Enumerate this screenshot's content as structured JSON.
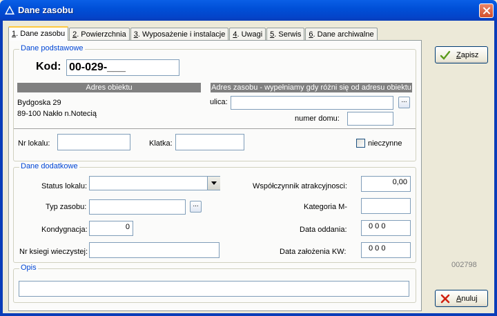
{
  "window": {
    "title": "Dane zasobu",
    "accent": "#0050d8"
  },
  "tabs": [
    {
      "key": "1",
      "label": ". Dane zasobu"
    },
    {
      "key": "2",
      "label": ". Powierzchnia"
    },
    {
      "key": "3",
      "label": ". Wyposażenie i instalacje"
    },
    {
      "key": "4",
      "label": ". Uwagi"
    },
    {
      "key": "5",
      "label": ". Serwis"
    },
    {
      "key": "6",
      "label": ". Dane archiwalne"
    }
  ],
  "basic": {
    "group_label": "Dane podstawowe",
    "code_label": "Kod:",
    "code_value": "00-029-___",
    "object_address_header": "Adres  obiektu",
    "object_address_line1": "Bydgoska 29",
    "object_address_line2": "89-100 Nakło n.Notecią",
    "resource_address_header": "Adres zasobu - wypełniamy gdy różni się od adresu obiektu",
    "street_label": "ulica:",
    "street_value": "",
    "house_number_label": "numer domu:",
    "house_number_value": "",
    "unit_number_label": "Nr lokalu:",
    "unit_number_value": "",
    "staircase_label": "Klatka:",
    "staircase_value": "",
    "inactive_label": "nieczynne",
    "browse_label": "..."
  },
  "additional": {
    "group_label": "Dane dodatkowe",
    "unit_status_label": "Status lokalu:",
    "unit_status_value": "",
    "resource_type_label": "Typ zasobu:",
    "resource_type_value": "",
    "floors_label": "Kondygnacja:",
    "floors_value": "0",
    "land_register_label": "Nr ksiegi wieczystej:",
    "land_register_value": "",
    "attractiveness_label": "Współczynnik atrakcyjnosci:",
    "attractiveness_value": "0,00",
    "category_label": "Kategoria M-",
    "category_value": "",
    "handover_date_label": "Data oddania:",
    "handover_date_value": "0 0  0",
    "kw_date_label": "Data założenia KW:",
    "kw_date_value": "0 0  0",
    "browse_label": "..."
  },
  "description": {
    "group_label": "Opis",
    "value": ""
  },
  "side": {
    "save_label": "Zapisz",
    "save_accel": "Z",
    "cancel_label": "Anuluj",
    "cancel_accel": "A",
    "record_id": "002798"
  }
}
